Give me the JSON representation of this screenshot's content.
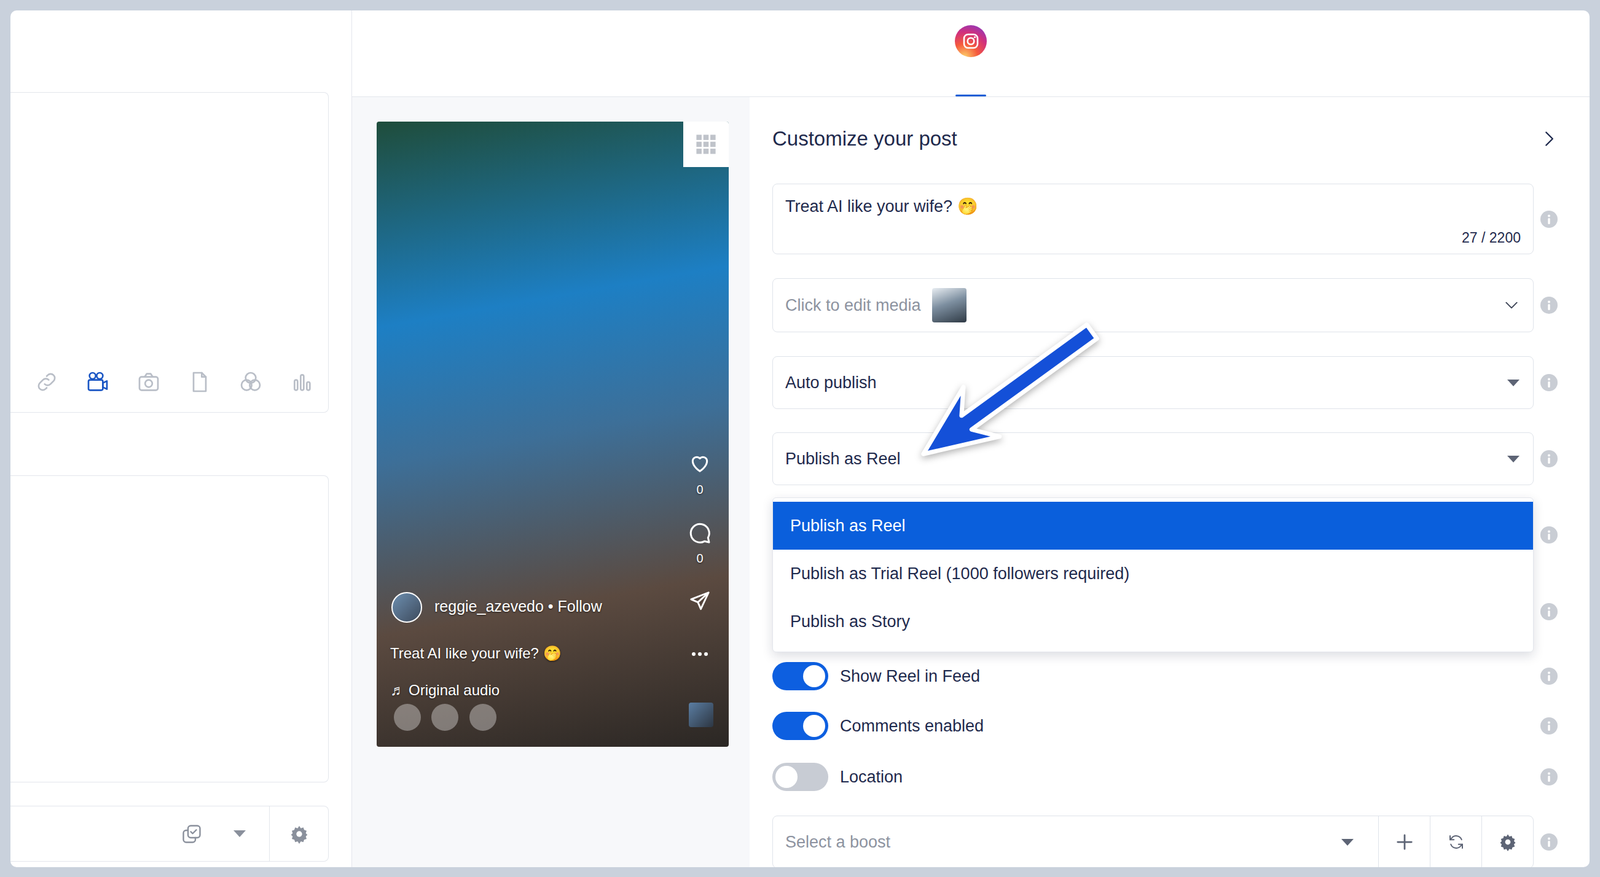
{
  "left_panel": {
    "attach_tools": [
      {
        "selected": false
      },
      {
        "selected": true
      },
      {
        "selected": false
      },
      {
        "selected": false
      },
      {
        "selected": false
      },
      {
        "selected": false
      }
    ]
  },
  "header": {
    "networks": [
      {
        "selected": true
      }
    ]
  },
  "preview": {
    "likes": "0",
    "comments": "0",
    "account": "reggie_azevedo • Follow",
    "caption": "Treat AI like your wife? 🤭",
    "audio_note": "♬",
    "audio": "Original audio"
  },
  "form": {
    "title": "Customize your post",
    "caption": {
      "value": "Treat AI like your wife? 🤭",
      "counter": "27 / 2200"
    },
    "media": {
      "placeholder": "Click to edit media"
    },
    "publish_mode": {
      "value": "Auto publish"
    },
    "post_type": {
      "value": "Publish as Reel",
      "expanded": true,
      "options": [
        {
          "label": "Publish as Reel",
          "selected": true
        },
        {
          "label": "Publish as Trial Reel (1000 followers required)",
          "selected": false
        },
        {
          "label": "Publish as Story",
          "selected": false
        }
      ]
    },
    "toggles": [
      {
        "label": "Show Reel in Feed",
        "on": true
      },
      {
        "label": "Comments enabled",
        "on": true
      },
      {
        "label": "Location",
        "on": false
      }
    ],
    "boost": {
      "placeholder": "Select a boost"
    }
  }
}
